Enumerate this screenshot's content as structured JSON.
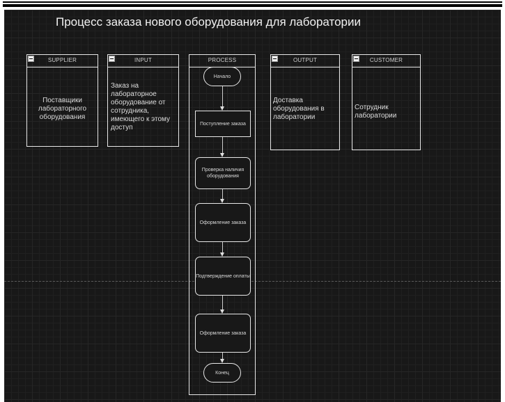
{
  "title": "Процесс заказа нового оборудования для лаборатории",
  "columns": {
    "supplier": {
      "label": "SUPPLIER",
      "text": "Поставщики лабораторного оборудования"
    },
    "input": {
      "label": "INPUT",
      "text": "Заказ на лабораторное оборудование от сотрудника, имеющего к этому доступ"
    },
    "process": {
      "label": "PROCESS"
    },
    "output": {
      "label": "OUTPUT",
      "text": "Доставка оборудования в лаборатории"
    },
    "customer": {
      "label": "CUSTOMER",
      "text": "Сотрудник лаборатории"
    }
  },
  "process_steps": [
    {
      "label": "Начало"
    },
    {
      "label": "Поступление заказа"
    },
    {
      "label": "Проверка наличия оборудования"
    },
    {
      "label": "Оформление заказа"
    },
    {
      "label": "Подтверждение оплаты"
    },
    {
      "label": "Оформление заказа"
    },
    {
      "label": "Конец"
    }
  ],
  "colors": {
    "canvas": "#181818",
    "grid": "#262626",
    "stroke": "#e8e8e8"
  }
}
